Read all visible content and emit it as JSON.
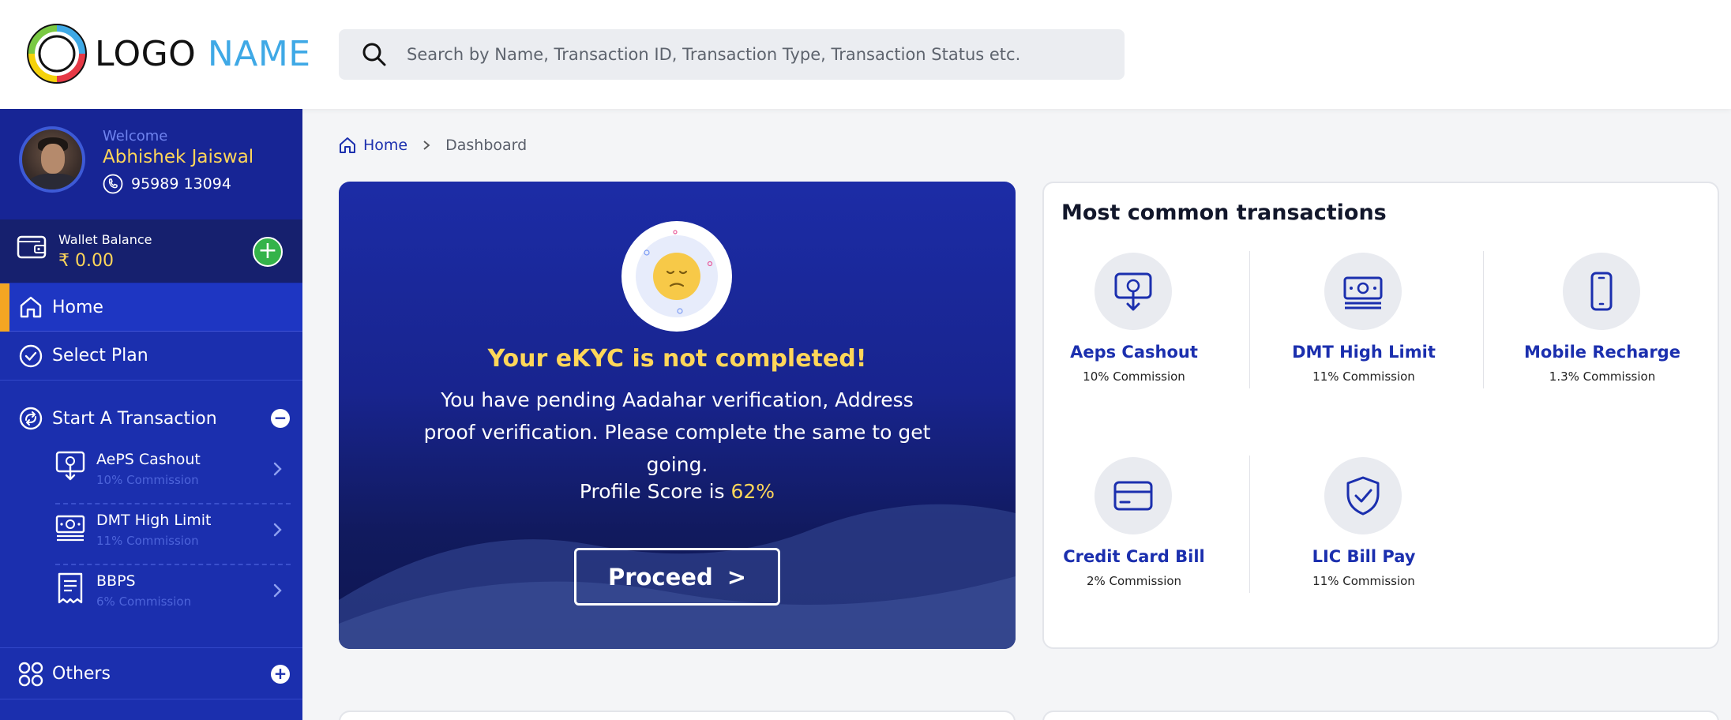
{
  "header": {
    "logo_word1": "LOGO",
    "logo_word2": "NAME",
    "search_placeholder": "Search by Name, Transaction ID, Transaction Type, Transaction Status etc."
  },
  "sidebar": {
    "welcome": "Welcome",
    "user_name": "Abhishek Jaiswal",
    "phone": "95989 13094",
    "wallet_label": "Wallet Balance",
    "wallet_amount": "₹ 0.00",
    "wallet_add": "+",
    "nav": {
      "home": "Home",
      "select_plan": "Select Plan",
      "start_transaction": "Start A Transaction",
      "start_transaction_toggle": "−",
      "others": "Others",
      "others_toggle": "+"
    },
    "sub_items": [
      {
        "title": "AePS Cashout",
        "commission": "10% Commission"
      },
      {
        "title": "DMT High Limit",
        "commission": "11% Commission"
      },
      {
        "title": "BBPS",
        "commission": "6% Commission"
      }
    ]
  },
  "breadcrumb": {
    "home": "Home",
    "current": "Dashboard"
  },
  "kyc": {
    "title": "Your eKYC is not completed!",
    "description": "You have pending Aadahar verification, Address proof verification. Please complete the same to get going.",
    "score_prefix": "Profile Score is",
    "score_value": "62%",
    "proceed_label": "Proceed",
    "proceed_arrow": ">"
  },
  "common": {
    "title": "Most common transactions",
    "items": [
      {
        "name": "Aeps Cashout",
        "commission": "10% Commission",
        "icon": "cashout-icon"
      },
      {
        "name": "DMT High Limit",
        "commission": "11% Commission",
        "icon": "banknote-icon"
      },
      {
        "name": "Mobile Recharge",
        "commission": "1.3% Commission",
        "icon": "mobile-icon"
      },
      {
        "name": "Credit Card Bill",
        "commission": "2% Commission",
        "icon": "credit-card-icon"
      },
      {
        "name": "LIC Bill Pay",
        "commission": "11% Commission",
        "icon": "shield-check-icon"
      }
    ]
  },
  "colors": {
    "primary": "#1b2fae",
    "accent_yellow": "#ffd659",
    "accent_orange": "#f4a623",
    "success_green": "#34b34a",
    "logo_blue": "#3fa9e6"
  }
}
